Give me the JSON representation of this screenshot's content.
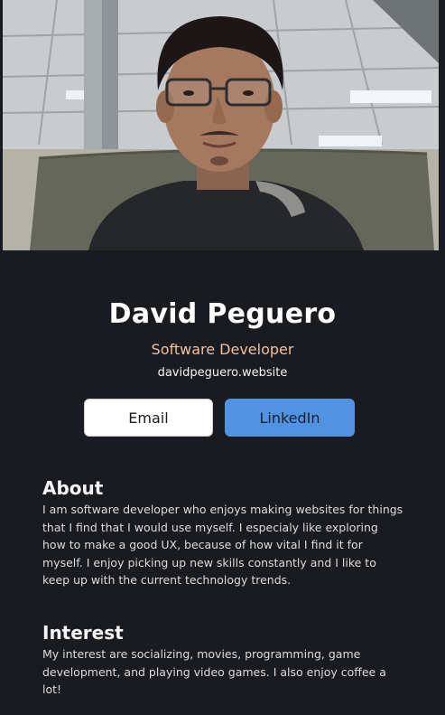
{
  "profile": {
    "photo_icon": "profile-photo",
    "name": "David Peguero",
    "role": "Software Developer",
    "website": "davidpeguero.website",
    "role_color": "#f3bf99"
  },
  "buttons": {
    "email_label": "Email",
    "linkedin_label": "LinkedIn",
    "linkedin_color": "#5093e2"
  },
  "about": {
    "heading": "About",
    "text": "I am software developer who enjoys making websites for things that I find that I would use myself. I especialy like exploring how to make a good UX, because of how vital I find it for myself. I enjoy picking up new skills constantly and I like to keep up with the current technology trends."
  },
  "interest": {
    "heading": "Interest",
    "text": "My interest are socializing, movies, programming, game development, and playing video games. I also enjoy coffee a lot!"
  }
}
